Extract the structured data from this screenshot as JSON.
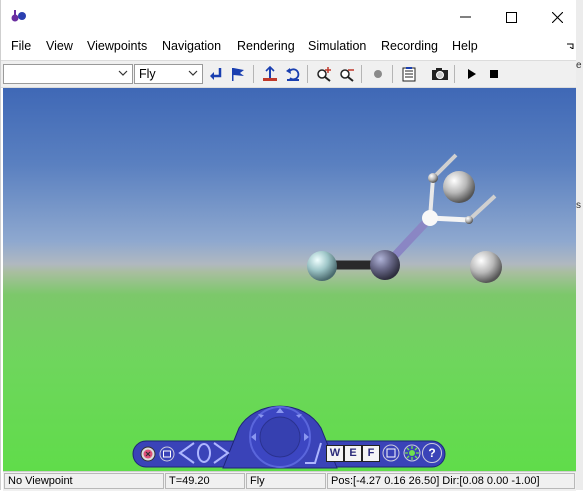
{
  "window": {
    "title": ""
  },
  "menubar": {
    "items": [
      "File",
      "View",
      "Viewpoints",
      "Navigation",
      "Rendering",
      "Simulation",
      "Recording",
      "Help"
    ]
  },
  "toolbar": {
    "viewpoint_combo_value": "",
    "navigation_mode_value": "Fly",
    "icons": [
      "return-icon",
      "flag-icon",
      "straighten-up-icon",
      "undo-move-icon",
      "zoom-in-icon",
      "zoom-out-icon",
      "record-dot-icon",
      "notes-icon",
      "camera-icon",
      "play-icon",
      "stop-icon"
    ]
  },
  "navpanel": {
    "buttons": [
      "close",
      "restore",
      "left-arrow",
      "right-arrow",
      "walk",
      "examine",
      "fly",
      "straighten",
      "headlight",
      "help"
    ],
    "labels": {
      "w": "W",
      "e": "E",
      "f": "F",
      "help": "?"
    }
  },
  "status": {
    "viewpoint": "No Viewpoint",
    "time": "T=49.20",
    "mode": "Fly",
    "position": "Pos:[-4.27 0.16 26.50] Dir:[0.08 0.00 -1.00]"
  },
  "background_edge": {
    "labels": [
      "e",
      "s"
    ]
  },
  "colors": {
    "sky_top": "#3f68b6",
    "ground": "#60dc4a",
    "navpanel": "#3a43b8",
    "accent_blue": "#1a3fb0"
  }
}
